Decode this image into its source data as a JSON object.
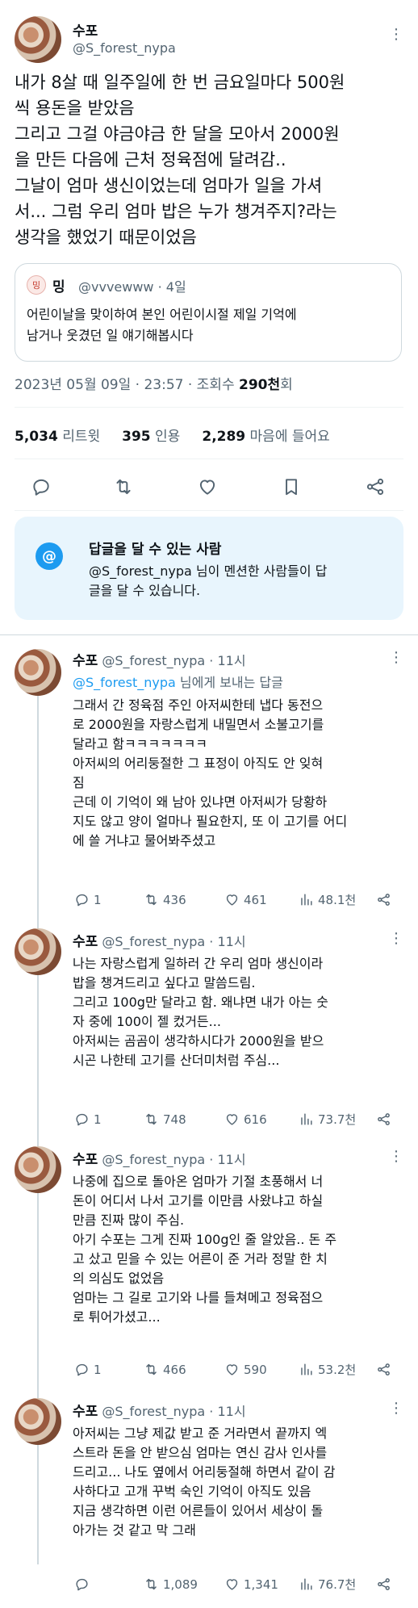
{
  "main_tweet": {
    "name": "수포",
    "handle": "@S_forest_nypa",
    "text": "내가 8살 때 일주일에 한 번 금요일마다 500원\n씩 용돈을 받았음\n그리고 그걸 야금야금 한 달을 모아서 2000원\n을 만든 다음에 근처 정육점에 달려감..\n그날이 엄마 생신이었는데 엄마가 일을 가셔\n서... 그럼 우리 엄마 밥은 누가 챙겨주지?라는\n생각을 했었기 때문이었음",
    "quote": {
      "avatar_label": "밍",
      "name": "밍",
      "handle_time": "@vvvewww · 4일",
      "text": "어린이날을 맞이하여 본인 어린이시절 제일 기억에\n남거나 웃겼던 일 얘기해봅시다"
    },
    "date": "2023년 05월 09일 · 23:57 · 조회수 ",
    "views": "290천",
    "views_suffix": "회",
    "stats": {
      "retweets": "5,034",
      "retweets_label": "리트윗",
      "quotes": "395",
      "quotes_label": "인용",
      "likes": "2,289",
      "likes_label": "마음에 들어요"
    }
  },
  "reply_box": {
    "icon": "@",
    "title": "답글을 달 수 있는 사람",
    "desc": "@S_forest_nypa 님이 멘션한 사람들이 답\n글을 달 수 있습니다."
  },
  "replies": [
    {
      "name": "수포",
      "handle_time": "@S_forest_nypa · 11시",
      "to_prefix": "@S_forest_nypa",
      "to_suffix": " 님에게 보내는 답글",
      "text": "그래서 간 정육점 주인 아저씨한테 냅다 동전으\n로 2000원을 자랑스럽게 내밀면서 소불고기를\n달라고 함ㅋㅋㅋㅋㅋㅋㅋ\n아저씨의 어리둥절한 그 표정이 아직도 안 잊혀\n짐\n근데 이 기억이 왜 남아 있냐면 아저씨가 당황하\n지도 않고 양이 얼마나 필요한지, 또 이 고기를 어디\n에 쓸 거냐고 물어봐주셨고",
      "replies": "1",
      "retweets": "436",
      "likes": "461",
      "views": "48.1천"
    },
    {
      "name": "수포",
      "handle_time": "@S_forest_nypa · 11시",
      "text": "나는 자랑스럽게 일하러 간 우리 엄마 생신이라\n밥을 챙겨드리고 싶다고 말씀드림.\n그리고 100g만 달라고 함. 왜냐면 내가 아는 숫\n자 중에 100이 젤 컸거든...\n아저씨는 곰곰이 생각하시다가 2000원을 받으\n시곤 나한테 고기를 산더미처럼 주심...",
      "replies": "1",
      "retweets": "748",
      "likes": "616",
      "views": "73.7천"
    },
    {
      "name": "수포",
      "handle_time": "@S_forest_nypa · 11시",
      "text": "나중에 집으로 돌아온 엄마가 기절 초풍해서 너\n돈이 어디서 나서 고기를 이만큼 사왔냐고 하실\n만큼 진짜 많이 주심.\n아기 수포는 그게 진짜 100g인 줄 알았음.. 돈 주\n고 샀고 믿을 수 있는 어른이 준 거라 정말 한 치\n의 의심도 없었음\n엄마는 그 길로 고기와 나를 들쳐메고 정육점으\n로 튀어가셨고...",
      "replies": "1",
      "retweets": "466",
      "likes": "590",
      "views": "53.2천"
    },
    {
      "name": "수포",
      "handle_time": "@S_forest_nypa · 11시",
      "text": "아저씨는 그냥 제값 받고 준 거라면서 끝까지 엑\n스트라 돈을 안 받으심 엄마는 연신 감사 인사를\n드리고... 나도 옆에서 어리둥절해 하면서 같이 감\n사하다고 고개 꾸벅 숙인 기억이 아직도 있음\n지금 생각하면 이런 어른들이 있어서 세상이 돌\n아가는 것 같고 막 그래",
      "replies": "",
      "retweets": "1,089",
      "likes": "1,341",
      "views": "76.7천"
    }
  ],
  "colors": {
    "accent": "#1d9bf0",
    "secondary_text": "#536471",
    "reply_box_bg": "#e8f5fd"
  }
}
